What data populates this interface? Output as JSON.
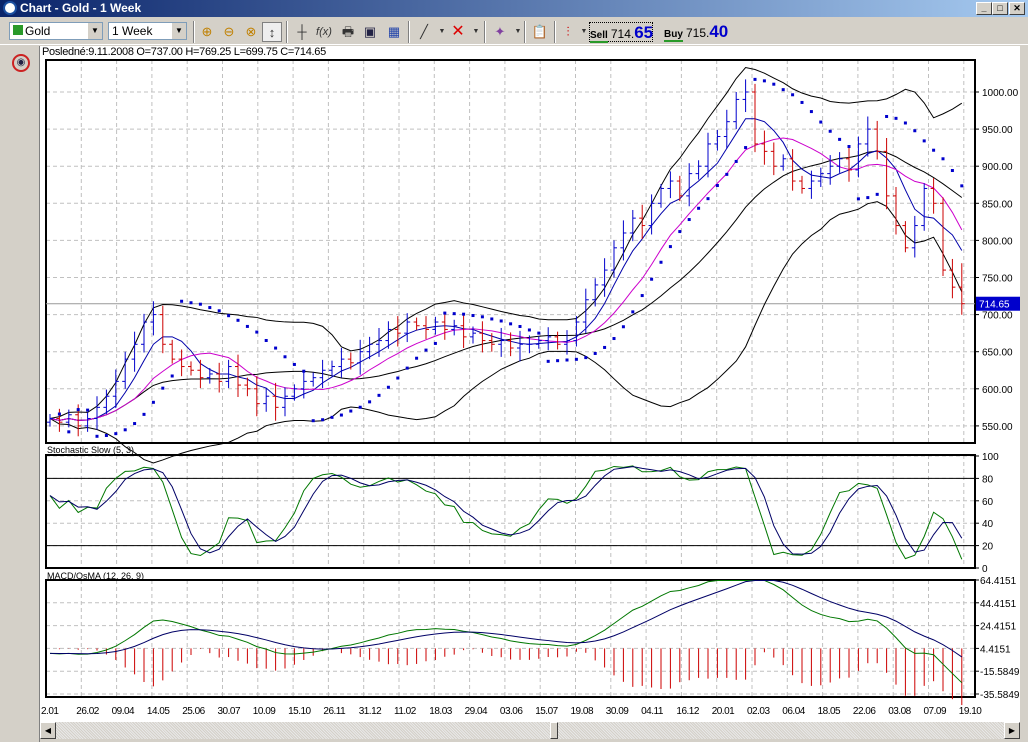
{
  "window": {
    "title": "Chart - Gold - 1 Week",
    "min": "_",
    "max": "□",
    "close": "✕"
  },
  "toolbar": {
    "symbol": "Gold",
    "period": "1 Week",
    "sell_label": "Sell",
    "sell_big": "714.",
    "sell_small": "65",
    "buy_label": "Buy",
    "buy_big": "715.",
    "buy_small": "40",
    "icons": [
      "zoom-in-icon",
      "zoom-out-icon",
      "zoom-reset-icon",
      "auto-scale-icon",
      "crosshair-icon",
      "function-icon",
      "print-icon",
      "save-icon",
      "table-icon",
      "line-tool-icon",
      "delete-icon",
      "markers-icon",
      "properties-icon",
      "chart-type-icon"
    ]
  },
  "info_line": "Posledné:9.11.2008 O=737.00 H=769.25 L=699.75 C=714.65",
  "colors": {
    "up": "#0000cc",
    "down": "#cc0000",
    "sar": "#0000cc",
    "ma_fast": "#0000aa",
    "ma_slow": "#cc00cc",
    "stoch_k": "#007700",
    "stoch_d": "#000066",
    "macd": "#007700",
    "signal": "#000066",
    "osma": "#cc0000",
    "last_price_bg": "#0000cc"
  },
  "chart_data": [
    {
      "type": "candlestick",
      "title": "",
      "last_price": "714.65",
      "ylim": [
        520,
        1040
      ],
      "y_ticks": [
        "1000.00",
        "950.00",
        "900.00",
        "850.00",
        "800.00",
        "750.00",
        "700.00",
        "650.00",
        "600.00",
        "550.00"
      ],
      "x_ticks": [
        "2.01",
        "26.02",
        "09.04",
        "14.05",
        "25.06",
        "30.07",
        "10.09",
        "15.10",
        "26.11",
        "31.12",
        "11.02",
        "18.03",
        "29.04",
        "03.06",
        "15.07",
        "19.08",
        "30.09",
        "04.11",
        "16.12",
        "20.01",
        "02.03",
        "06.04",
        "18.05",
        "22.06",
        "03.08",
        "07.09",
        "19.10"
      ],
      "close": [
        560,
        555,
        565,
        550,
        560,
        575,
        590,
        610,
        640,
        660,
        690,
        700,
        660,
        640,
        630,
        625,
        615,
        620,
        610,
        630,
        605,
        600,
        580,
        590,
        575,
        590,
        600,
        610,
        615,
        625,
        630,
        640,
        635,
        650,
        660,
        665,
        680,
        675,
        690,
        685,
        680,
        690,
        680,
        685,
        670,
        675,
        665,
        660,
        665,
        655,
        660,
        660,
        665,
        670,
        660,
        665,
        690,
        720,
        740,
        760,
        790,
        810,
        830,
        820,
        850,
        870,
        880,
        860,
        890,
        900,
        930,
        940,
        960,
        990,
        1000,
        930,
        920,
        900,
        910,
        880,
        870,
        880,
        890,
        900,
        910,
        895,
        930,
        950,
        920,
        860,
        820,
        790,
        820,
        870,
        850,
        760,
        737,
        714.65
      ],
      "overlays": [
        "Bollinger Bands",
        "Moving Average",
        "Moving Average",
        "Parabolic SAR"
      ]
    },
    {
      "type": "line",
      "title": "Stochastic Slow (5, 3)",
      "ylim": [
        0,
        100
      ],
      "y_ticks": [
        "100",
        "80",
        "60",
        "40",
        "20",
        "0"
      ],
      "levels": [
        20,
        80
      ]
    },
    {
      "type": "line+bar",
      "title": "MACD/OsMA (12, 26, 9)",
      "ylim": [
        -35.5849,
        64.4151
      ],
      "y_ticks": [
        "64.4151",
        "44.4151",
        "24.4151",
        "4.4151",
        "-15.5849",
        "-35.5849"
      ]
    }
  ]
}
